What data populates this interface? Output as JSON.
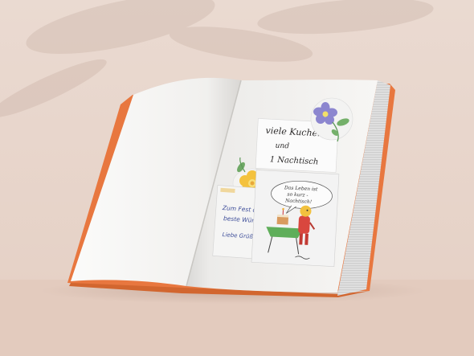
{
  "scene": {
    "background_color": "#e8d6cc",
    "book_cover_color": "#e8773f",
    "page_color": "#f7f6f4"
  },
  "note_card": {
    "line1": "viele Kuchen",
    "line2": "und",
    "line3": "1 Nachtisch"
  },
  "letter": {
    "line1": "Zum Fest die",
    "line2": "beste Wünsche",
    "line3": "Liebe Grüße"
  },
  "cartoon_card": {
    "bubble_line1": "Das Leben ist",
    "bubble_line2": "so kurz -",
    "bubble_line3": "Nachtisch!"
  },
  "flowers": {
    "purple_flower": "purple-flower-sticker",
    "yellow_flower": "yellow-flower-sticker"
  }
}
